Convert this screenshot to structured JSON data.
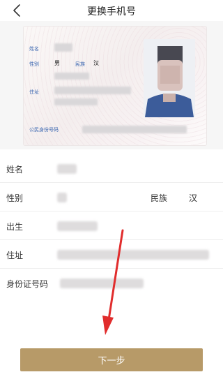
{
  "header": {
    "title": "更换手机号"
  },
  "id_card": {
    "name_label": "姓名",
    "gender_label": "性别",
    "gender_value": "男",
    "ethnicity_label": "民族",
    "ethnicity_value": "汉",
    "address_label": "住址",
    "id_number_label": "公民身份号码"
  },
  "form": {
    "rows": [
      {
        "label": "姓名"
      },
      {
        "label": "性别",
        "extra_label": "民族",
        "extra_value": "汉"
      },
      {
        "label": "出生"
      },
      {
        "label": "住址"
      },
      {
        "label": "身份证号码"
      }
    ]
  },
  "footer": {
    "next_button": "下一步"
  },
  "colors": {
    "button": "#b79a68",
    "arrow": "#e12d2d",
    "card_label": "#3a66b0"
  },
  "icons": {
    "back": "chevron-left-icon"
  }
}
